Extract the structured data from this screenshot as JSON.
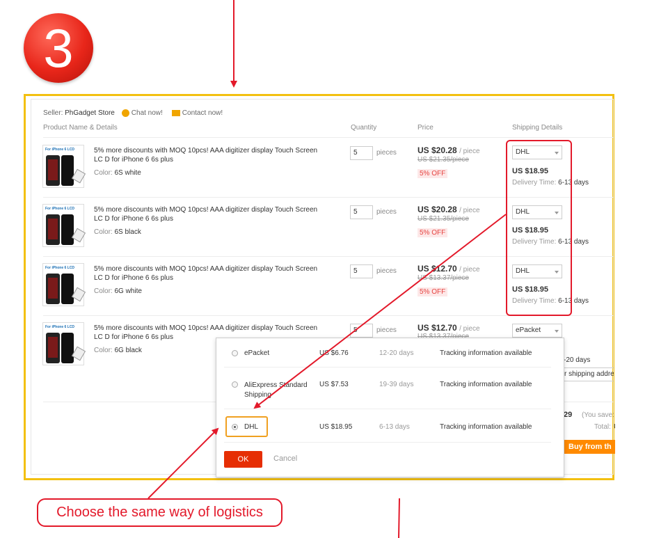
{
  "step_number": "3",
  "seller": {
    "label": "Seller:",
    "name": "PhGadget Store",
    "chat": "Chat now!",
    "contact": "Contact now!"
  },
  "headers": {
    "product": "Product Name & Details",
    "quantity": "Quantity",
    "price": "Price",
    "shipping": "Shipping Details"
  },
  "items": [
    {
      "tag": "For iPhone 6 LCD",
      "title": "5% more discounts with MOQ 10pcs! AAA digitizer display Touch Screen LC D for iPhone 6 6s plus",
      "color_label": "Color:",
      "color": "6S white",
      "qty": "5",
      "pieces": "pieces",
      "price": "US $20.28",
      "per": "/ piece",
      "old": "US $21.35/piece",
      "off": "5% OFF",
      "ship_method": "DHL",
      "ship_price": "US $18.95",
      "delivery_label": "Delivery Time:",
      "delivery": "6-13 days"
    },
    {
      "tag": "For iPhone 6 LCD",
      "title": "5% more discounts with MOQ 10pcs! AAA digitizer display Touch Screen LC D for iPhone 6 6s plus",
      "color_label": "Color:",
      "color": "6S black",
      "qty": "5",
      "pieces": "pieces",
      "price": "US $20.28",
      "per": "/ piece",
      "old": "US $21.35/piece",
      "off": "5% OFF",
      "ship_method": "DHL",
      "ship_price": "US $18.95",
      "delivery_label": "Delivery Time:",
      "delivery": "6-13 days"
    },
    {
      "tag": "For iPhone 6 LCD",
      "title": "5% more discounts with MOQ 10pcs! AAA digitizer display Touch Screen LC D for iPhone 6 6s plus",
      "color_label": "Color:",
      "color": "6G white",
      "qty": "5",
      "pieces": "pieces",
      "price": "US $12.70",
      "per": "/ piece",
      "old": "US $13.37/piece",
      "off": "5% OFF",
      "ship_method": "DHL",
      "ship_price": "US $18.95",
      "delivery_label": "Delivery Time:",
      "delivery": "6-13 days"
    },
    {
      "tag": "For iPhone 6 LCD",
      "title": "5% more discounts with MOQ 10pcs! AAA digitizer display Touch Screen LC D for iPhone 6 6s plus",
      "color_label": "Color:",
      "color": "6G black",
      "qty": "5",
      "pieces": "pieces",
      "price": "US $12.70",
      "per": "/ piece",
      "old": "US $13.37/piece",
      "ship_method": "ePacket",
      "delivery_partial": "-20 days",
      "address_partial": "r shipping addres"
    }
  ],
  "popup": {
    "options": [
      {
        "name": "ePacket",
        "price": "US $6.76",
        "days": "12-20 days",
        "tracking": "Tracking information available",
        "selected": false
      },
      {
        "name": "AliExpress Standard Shipping",
        "price": "US $7.53",
        "days": "19-39 days",
        "tracking": "Tracking information available",
        "selected": false
      },
      {
        "name": "DHL",
        "price": "US $18.95",
        "days": "6-13 days",
        "tracking": "Tracking information available",
        "selected": true
      }
    ],
    "ok": "OK",
    "cancel": "Cancel"
  },
  "summary": {
    "amount_partial": "29",
    "you_save_partial": "(You save:",
    "total_label": "Total:",
    "total_partial": "U",
    "buy_partial": "Buy from th"
  },
  "callout": "Choose the same way of logistics",
  "colors": {
    "accent_red": "#e3192a",
    "panel_border": "#f3c010",
    "ok_button": "#e62e04",
    "buy_button": "#ff8a00"
  }
}
